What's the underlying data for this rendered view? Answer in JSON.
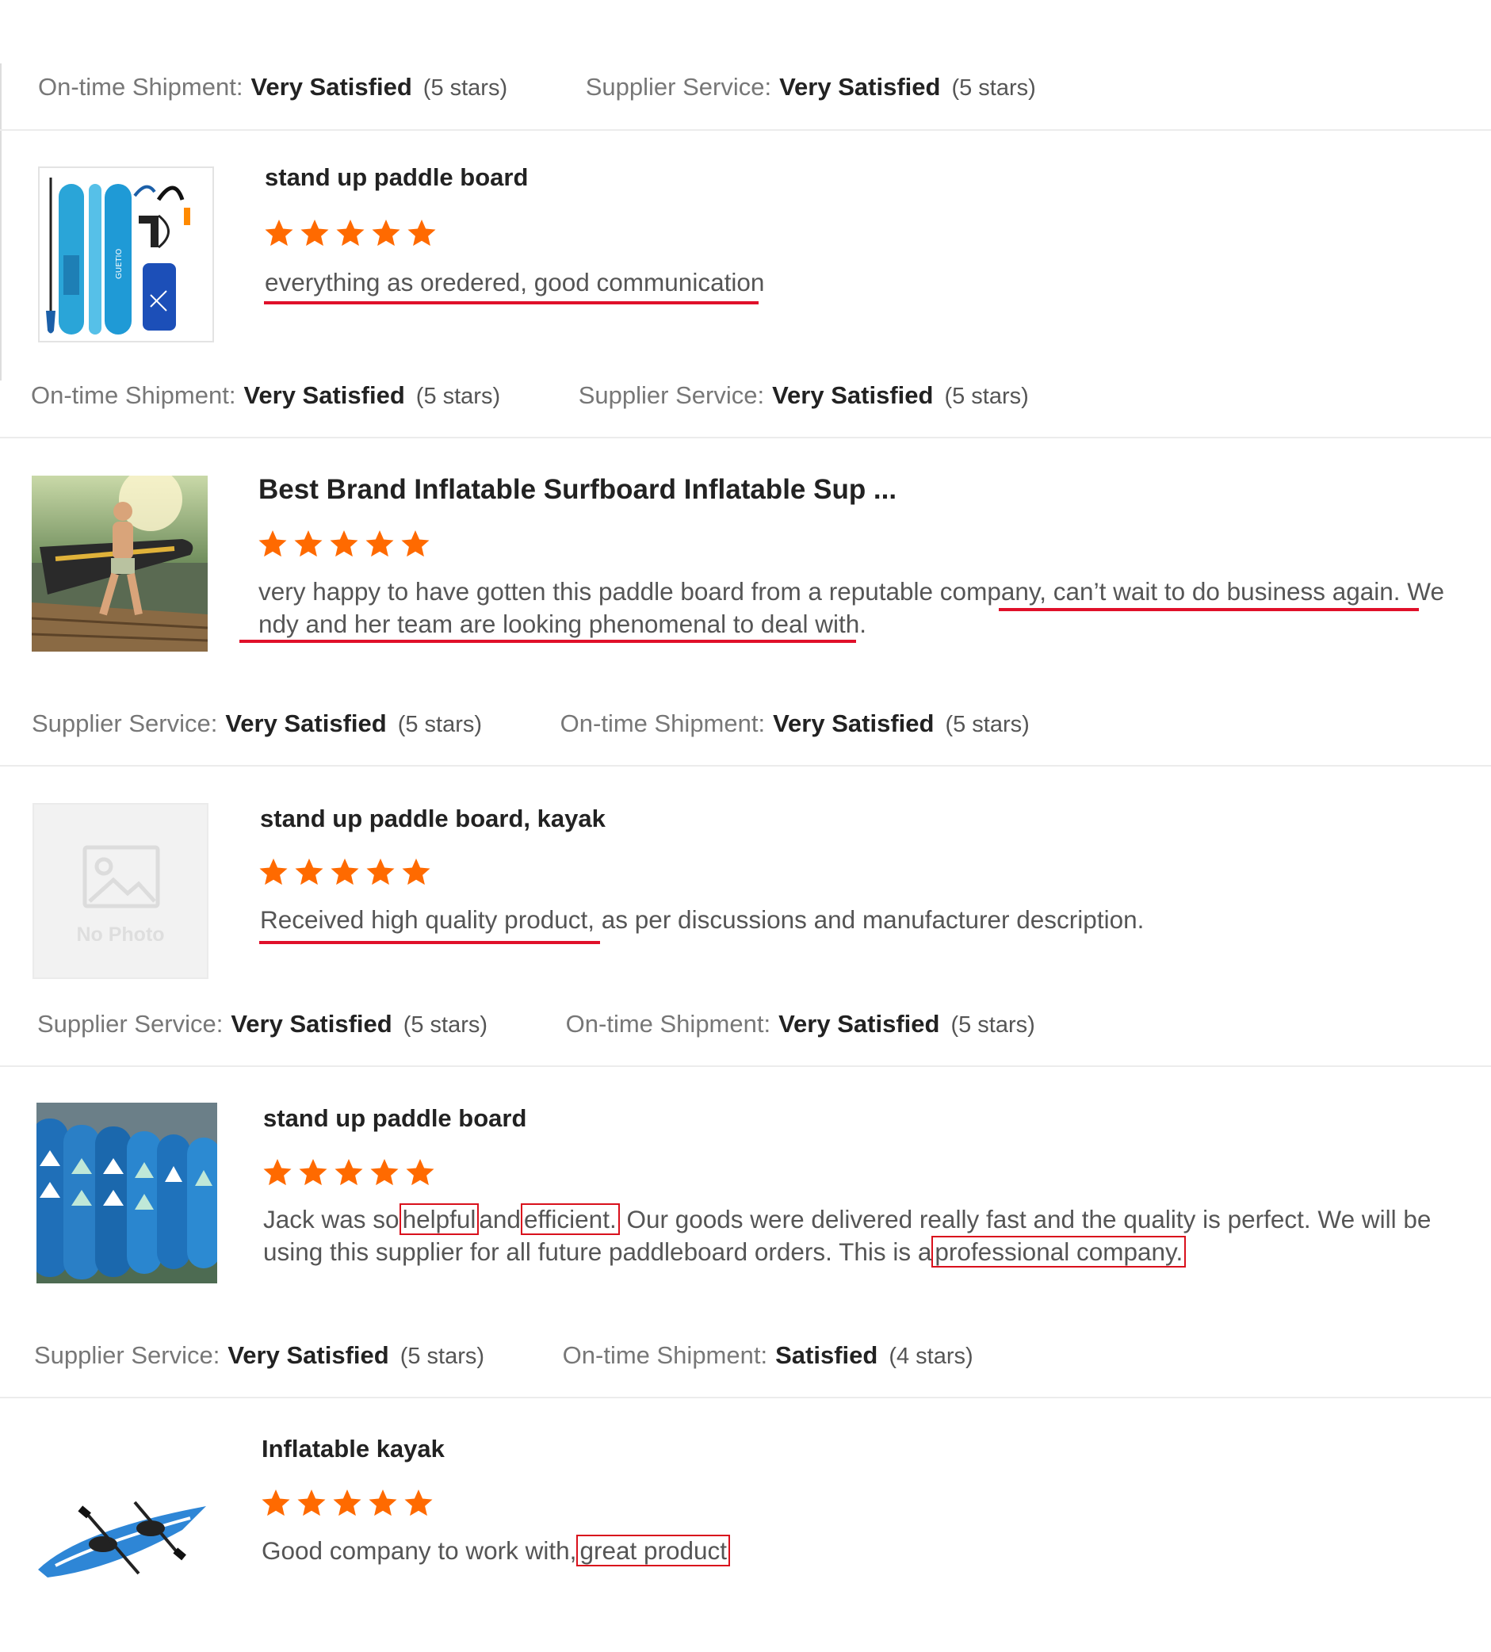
{
  "accent_color": "#ff6a00",
  "highlight_color": "#e0102a",
  "ratings": [
    {
      "a_label": "On-time Shipment:",
      "a_value": "Very Satisfied",
      "a_stars": "(5 stars)",
      "b_label": "Supplier Service:",
      "b_value": "Very Satisfied",
      "b_stars": "(5 stars)"
    },
    {
      "a_label": "On-time Shipment:",
      "a_value": "Very Satisfied",
      "a_stars": "(5 stars)",
      "b_label": "Supplier Service:",
      "b_value": "Very Satisfied",
      "b_stars": "(5 stars)"
    },
    {
      "a_label": "Supplier Service:",
      "a_value": "Very Satisfied",
      "a_stars": "(5 stars)",
      "b_label": "On-time Shipment:",
      "b_value": "Very Satisfied",
      "b_stars": "(5 stars)"
    },
    {
      "a_label": "Supplier Service:",
      "a_value": "Very Satisfied",
      "a_stars": "(5 stars)",
      "b_label": "On-time Shipment:",
      "b_value": "Very Satisfied",
      "b_stars": "(5 stars)"
    },
    {
      "a_label": "Supplier Service:",
      "a_value": "Very Satisfied",
      "a_stars": "(5 stars)",
      "b_label": "On-time Shipment:",
      "b_value": "Satisfied",
      "b_stars": "(4 stars)"
    }
  ],
  "reviews": [
    {
      "title": "stand up paddle board",
      "stars": 5,
      "comment": "everything as oredered, good communication",
      "image": "paddle-board-set"
    },
    {
      "title": "Best Brand Inflatable Surfboard Inflatable Sup ...",
      "stars": 5,
      "comment_part1": "very happy to have gotten this paddle board from a reputable company, can’t wait to do business again. We",
      "comment_part2": "ndy and her team are looking phenomenal to deal with.",
      "image": "man-on-paddle-board"
    },
    {
      "title": "stand up paddle board, kayak",
      "stars": 5,
      "comment": "Received high quality product, as per discussions and manufacturer description.",
      "image": "no-photo",
      "no_photo_text": "No Photo"
    },
    {
      "title": "stand up paddle board",
      "stars": 5,
      "c1": "Jack was so",
      "c2": "helpful",
      "c3": "and",
      "c4": "efficient.",
      "c5": "Our goods were delivered really fast and the quality is perfect. We will be",
      "c6": "using this supplier for all future paddleboard orders. This is a",
      "c7": "professional company.",
      "image": "paddle-boards-warehouse"
    },
    {
      "title": "Inflatable kayak",
      "stars": 5,
      "c1": "Good company to work with,",
      "c2": "great product",
      "image": "inflatable-kayak"
    }
  ]
}
